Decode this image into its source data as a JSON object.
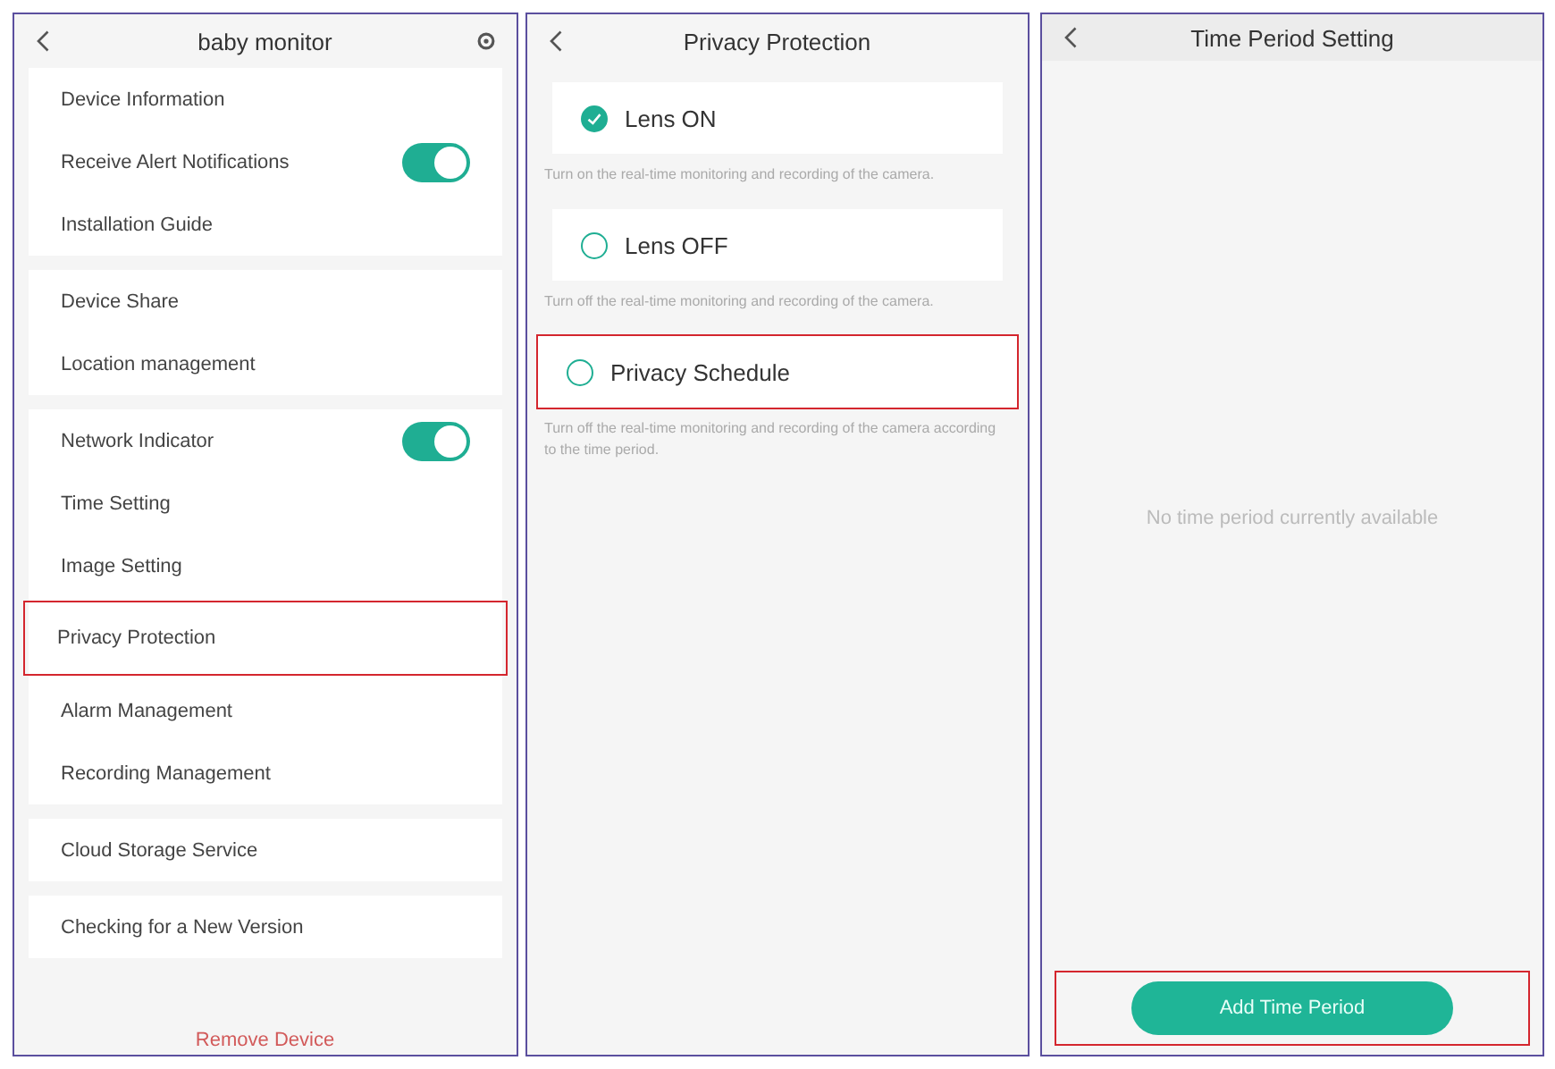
{
  "panels": [
    {
      "kind": "settings",
      "title": "baby monitor",
      "groups": [
        {
          "items": [
            {
              "label": "Device Information",
              "kind": "link",
              "highlighted": false
            },
            {
              "label": "Receive Alert Notifications",
              "kind": "toggle",
              "on": true,
              "highlighted": false
            },
            {
              "label": "Installation Guide",
              "kind": "link",
              "highlighted": false
            }
          ]
        },
        {
          "items": [
            {
              "label": "Device Share",
              "kind": "link",
              "highlighted": false
            },
            {
              "label": "Location management",
              "kind": "link",
              "highlighted": false
            }
          ]
        },
        {
          "items": [
            {
              "label": "Network Indicator",
              "kind": "toggle",
              "on": true,
              "highlighted": false
            },
            {
              "label": "Time Setting",
              "kind": "link",
              "highlighted": false
            },
            {
              "label": "Image Setting",
              "kind": "link",
              "highlighted": false
            },
            {
              "label": "Privacy Protection",
              "kind": "link",
              "highlighted": true
            },
            {
              "label": "Alarm Management",
              "kind": "link",
              "highlighted": false
            },
            {
              "label": "Recording Management",
              "kind": "link",
              "highlighted": false
            }
          ]
        },
        {
          "items": [
            {
              "label": "Cloud Storage Service",
              "kind": "link",
              "highlighted": false
            }
          ]
        },
        {
          "items": [
            {
              "label": "Checking for a New Version",
              "kind": "link",
              "highlighted": false
            }
          ]
        }
      ],
      "footer_action": "Remove Device"
    },
    {
      "kind": "options",
      "title": "Privacy Protection",
      "options": [
        {
          "label": "Lens ON",
          "selected": true,
          "highlighted": false,
          "description": "Turn on the real-time monitoring and recording of the camera."
        },
        {
          "label": "Lens OFF",
          "selected": false,
          "highlighted": false,
          "description": "Turn off the real-time monitoring and recording of the camera."
        },
        {
          "label": "Privacy Schedule",
          "selected": false,
          "highlighted": true,
          "description": "Turn off the real-time monitoring and recording of the camera according to the time period."
        }
      ]
    },
    {
      "kind": "empty",
      "title": "Time Period Setting",
      "empty_message": "No time period currently available",
      "button": {
        "label": "Add Time Period",
        "highlighted": true
      }
    }
  ]
}
